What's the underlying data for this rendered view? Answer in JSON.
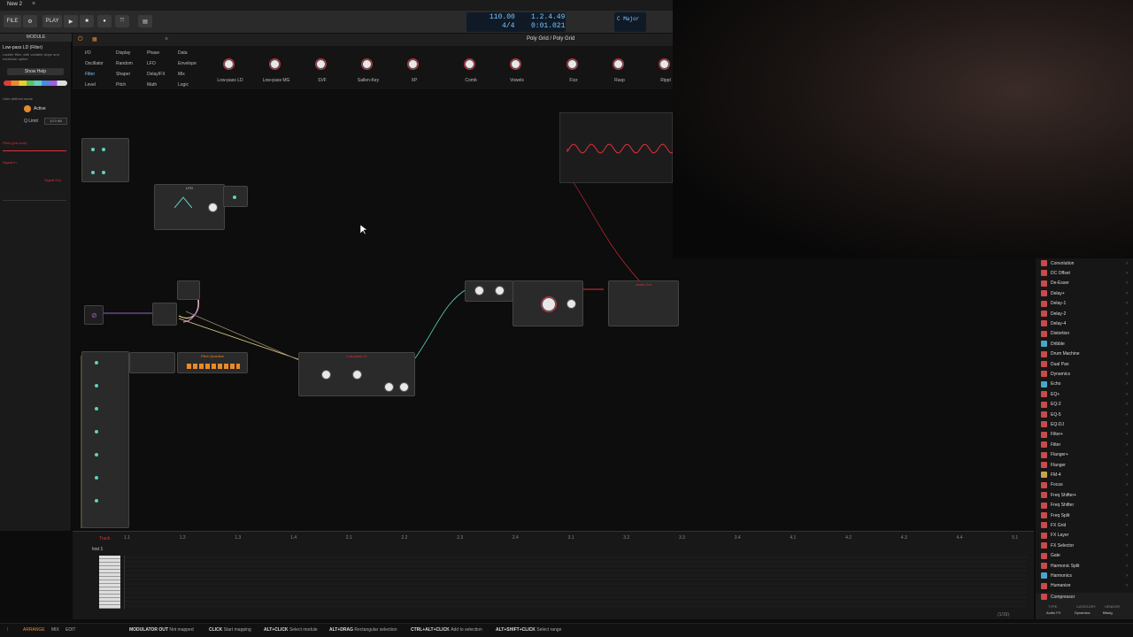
{
  "window": {
    "tab_title": "New 2",
    "close_glyph": "×"
  },
  "transport": {
    "file_label": "FILE",
    "play_label": "PLAY",
    "tempo": "110.00",
    "time_signature": "4/4",
    "position_bars": "1.2.4.49",
    "position_time": "0:01.021",
    "key": "C Major"
  },
  "editor": {
    "title": "Poly Grid / Poly Grid"
  },
  "inspector": {
    "header": "MODULE",
    "module_name": "Low-pass LD (Filter)",
    "module_desc": "Ladder filter, with variable slope and nonlinear option",
    "help_button": "Show Help",
    "active_label": "Active",
    "user_defined": "User-defined name",
    "q_limit_label": "Q Limit",
    "q_limit_value": "10.0 dB",
    "pitch_label": "Pitch (pre-cord)",
    "signal_in": "Signal In",
    "signal_out": "Signal Out"
  },
  "browser": {
    "categories": [
      [
        "I/O",
        "Display",
        "Phase",
        "Data"
      ],
      [
        "Oscillator",
        "Random",
        "LFO",
        "Envelope"
      ],
      [
        "Filter",
        "Shaper",
        "Delay/FX",
        "Mix"
      ],
      [
        "Level",
        "Pitch",
        "Math",
        "Logic"
      ]
    ],
    "selected_category": "Filter",
    "devices": [
      "Low-pass LD",
      "Low-pass MG",
      "SVF",
      "Sallen-Key",
      "XP",
      "Comb",
      "Vowels",
      "Fizz",
      "Rasp",
      "Rippl"
    ]
  },
  "device_list": {
    "items": [
      {
        "label": "Convolution",
        "color": "#c94a4a"
      },
      {
        "label": "DC Offset",
        "color": "#c94a4a"
      },
      {
        "label": "De-Esser",
        "color": "#c94a4a"
      },
      {
        "label": "Delay+",
        "color": "#c94a4a"
      },
      {
        "label": "Delay-1",
        "color": "#c94a4a"
      },
      {
        "label": "Delay-2",
        "color": "#c94a4a"
      },
      {
        "label": "Delay-4",
        "color": "#c94a4a"
      },
      {
        "label": "Distortion",
        "color": "#c94a4a"
      },
      {
        "label": "Dribble",
        "color": "#4aa6c9"
      },
      {
        "label": "Drum Machine",
        "color": "#c94a4a"
      },
      {
        "label": "Dual Pan",
        "color": "#c94a4a"
      },
      {
        "label": "Dynamics",
        "color": "#c94a4a"
      },
      {
        "label": "Echo",
        "color": "#4aa6c9"
      },
      {
        "label": "EQ+",
        "color": "#c94a4a"
      },
      {
        "label": "EQ-2",
        "color": "#c94a4a"
      },
      {
        "label": "EQ-5",
        "color": "#c94a4a"
      },
      {
        "label": "EQ-DJ",
        "color": "#c94a4a"
      },
      {
        "label": "Filter+",
        "color": "#c94a4a"
      },
      {
        "label": "Filter",
        "color": "#c94a4a"
      },
      {
        "label": "Flanger+",
        "color": "#c94a4a"
      },
      {
        "label": "Flanger",
        "color": "#c94a4a"
      },
      {
        "label": "FM-4",
        "color": "#c9a34a"
      },
      {
        "label": "Focus",
        "color": "#c94a4a"
      },
      {
        "label": "Freq Shifter+",
        "color": "#c94a4a"
      },
      {
        "label": "Freq Shifter",
        "color": "#c94a4a"
      },
      {
        "label": "Freq Split",
        "color": "#c94a4a"
      },
      {
        "label": "FX Grid",
        "color": "#c94a4a"
      },
      {
        "label": "FX Layer",
        "color": "#c94a4a"
      },
      {
        "label": "FX Selector",
        "color": "#c94a4a"
      },
      {
        "label": "Gate",
        "color": "#c94a4a"
      },
      {
        "label": "Harmonic Split",
        "color": "#c94a4a"
      },
      {
        "label": "Harmonics",
        "color": "#4aa6c9"
      },
      {
        "label": "Humanize",
        "color": "#c94a4a"
      }
    ],
    "footer_item": "Compressor",
    "footer_tabs": [
      "TYPE",
      "CATEGORY",
      "VENDOR"
    ],
    "footer_values": [
      "Audio FX",
      "Dynamics",
      "Bitwig"
    ]
  },
  "grid_modules": {
    "lfo_title": "LFO",
    "scope_title": "",
    "filter_title": "Low-pass LD",
    "pitch_quantize": "Pitch Quantize",
    "output_title": "Audio Out"
  },
  "arranger": {
    "track_tab": "Track",
    "inst_label": "Inst 1",
    "ruler": [
      "1.1",
      "1.2",
      "1.3",
      "1.4",
      "2.1",
      "2.2",
      "2.3",
      "2.4",
      "3.1",
      "3.2",
      "3.3",
      "3.4",
      "4.1",
      "4.2",
      "4.3",
      "4.4",
      "5.1"
    ],
    "page_counter": "(1/16)"
  },
  "statusbar": {
    "arrange": "ARRANGE",
    "mix": "MIX",
    "edit": "EDIT",
    "hints": [
      {
        "key": "MODULATOR OUT",
        "desc": "Not mapped"
      },
      {
        "key": "CLICK",
        "desc": "Start mapping"
      },
      {
        "key": "ALT+CLICK",
        "desc": "Select module"
      },
      {
        "key": "ALT+DRAG",
        "desc": "Rectangular selection"
      },
      {
        "key": "CTRL+ALT+CLICK",
        "desc": "Add to selection"
      },
      {
        "key": "ALT+SHIFT+CLICK",
        "desc": "Select range"
      }
    ]
  },
  "colors": {
    "accent": "#ff6a00",
    "teal": "#5fd0c0",
    "red": "#e0303a",
    "orange": "#e88a2a"
  }
}
